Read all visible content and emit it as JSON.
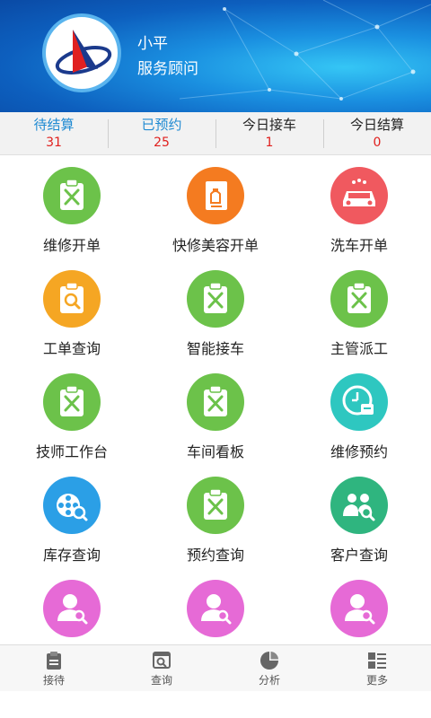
{
  "profile": {
    "name": "小平",
    "role": "服务顾问",
    "logo_icon": "company-logo"
  },
  "stats": [
    {
      "label": "待结算",
      "value": "31",
      "label_color": "#1f8ad2"
    },
    {
      "label": "已预约",
      "value": "25",
      "label_color": "#1f8ad2"
    },
    {
      "label": "今日接车",
      "value": "1",
      "label_color": "#222222"
    },
    {
      "label": "今日结算",
      "value": "0",
      "label_color": "#222222"
    }
  ],
  "menu": [
    {
      "label": "维修开单",
      "icon": "clipboard-tools-icon",
      "color": "#6cc24a"
    },
    {
      "label": "快修美容开单",
      "icon": "spray-bottle-icon",
      "color": "#f47b20"
    },
    {
      "label": "洗车开单",
      "icon": "car-wash-icon",
      "color": "#f0595f"
    },
    {
      "label": "工单查询",
      "icon": "clipboard-search-icon",
      "color": "#f5a623"
    },
    {
      "label": "智能接车",
      "icon": "clipboard-tools-icon",
      "color": "#6cc24a"
    },
    {
      "label": "主管派工",
      "icon": "clipboard-tools-icon",
      "color": "#6cc24a"
    },
    {
      "label": "技师工作台",
      "icon": "clipboard-tools-icon",
      "color": "#6cc24a"
    },
    {
      "label": "车间看板",
      "icon": "clipboard-tools-icon",
      "color": "#6cc24a"
    },
    {
      "label": "维修预约",
      "icon": "clock-calendar-icon",
      "color": "#2ec7c0"
    },
    {
      "label": "库存查询",
      "icon": "reel-search-icon",
      "color": "#2b9fe6"
    },
    {
      "label": "预约查询",
      "icon": "clipboard-tools-icon",
      "color": "#6cc24a"
    },
    {
      "label": "客户查询",
      "icon": "people-search-icon",
      "color": "#2fb57f"
    },
    {
      "label": "",
      "icon": "person-search-icon",
      "color": "#e66ad6"
    },
    {
      "label": "",
      "icon": "person-search-icon",
      "color": "#e66ad6"
    },
    {
      "label": "",
      "icon": "person-search-icon",
      "color": "#e66ad6"
    }
  ],
  "tabs": [
    {
      "label": "接待",
      "icon": "clipboard-icon"
    },
    {
      "label": "查询",
      "icon": "search-board-icon"
    },
    {
      "label": "分析",
      "icon": "pie-chart-icon"
    },
    {
      "label": "更多",
      "icon": "list-grid-icon"
    }
  ]
}
